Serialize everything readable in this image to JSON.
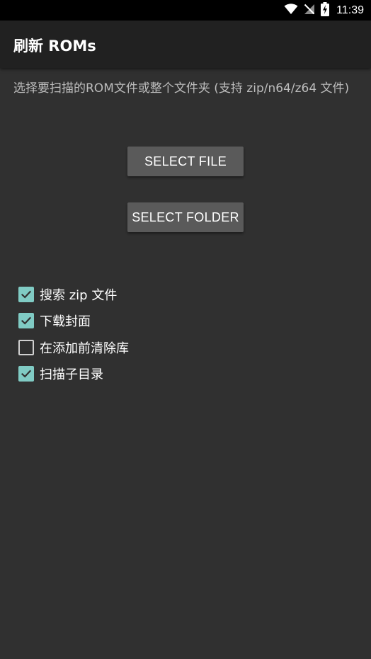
{
  "status_bar": {
    "time": "11:39",
    "icons": [
      "wifi-icon",
      "no-signal-icon",
      "battery-charging-icon"
    ]
  },
  "app_bar": {
    "title": "刷新 ROMs"
  },
  "description": "选择要扫描的ROM文件或整个文件夹 (支持 zip/n64/z64 文件)",
  "buttons": {
    "select_file": "SELECT FILE",
    "select_folder": "SELECT FOLDER"
  },
  "options": [
    {
      "label": "搜索 zip 文件",
      "checked": true
    },
    {
      "label": "下载封面",
      "checked": true
    },
    {
      "label": "在添加前清除库",
      "checked": false
    },
    {
      "label": "扫描子目录",
      "checked": true
    }
  ],
  "colors": {
    "background": "#303030",
    "app_bar": "#212121",
    "status_bar": "#000000",
    "button": "#5a5a5a",
    "checkbox_accent": "#80cbc4",
    "description_text": "#bdbdbd"
  }
}
